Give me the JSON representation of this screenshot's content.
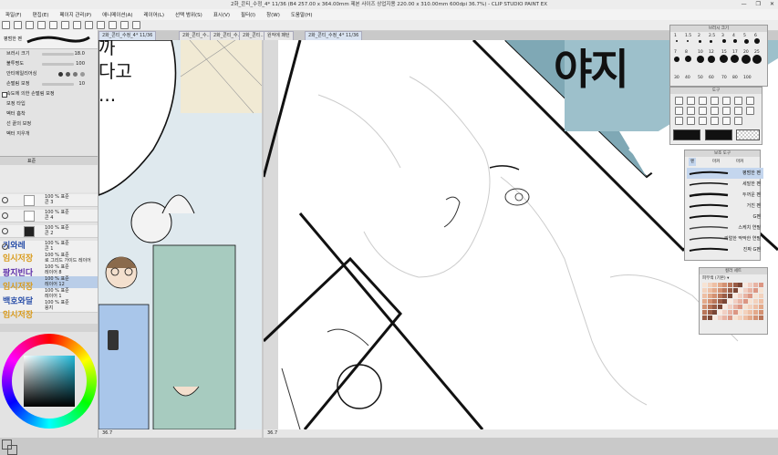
{
  "window": {
    "title": "2화_콘티_수정_4* 11/36 (B4 257.00 x 364.00mm 제본 사이즈 상업지용 220.00 x 310.00mm 600dpi 36.7%) - CLIP STUDIO PAINT EX",
    "controls": [
      "—",
      "❐",
      "✕"
    ]
  },
  "menu": [
    "파일(F)",
    "편집(E)",
    "페이지 관리(P)",
    "애니메이션(A)",
    "레이어(L)",
    "선택 범위(S)",
    "표시(V)",
    "필터(I)",
    "창(W)",
    "도움말(H)"
  ],
  "tool_property": {
    "rows": [
      {
        "label": "브러시 크기",
        "value": "18.0"
      },
      {
        "label": "불투명도",
        "value": "100"
      },
      {
        "label": "안티에일리어싱",
        "value": ""
      },
      {
        "label": "손떨림 보정",
        "value": "10"
      },
      {
        "label": "속도에 의한 손떨림 보정",
        "value": ""
      },
      {
        "label": "보정 타입",
        "value": ""
      },
      {
        "label": "벡터 흡착",
        "value": ""
      },
      {
        "label": "선 끝의 보정",
        "value": ""
      },
      {
        "label": "벡터 지우개",
        "value": ""
      }
    ],
    "brush_name": "평범한 펜"
  },
  "layers": {
    "blend_mode": "표준",
    "rows": [
      {
        "pct": "100 % 표준",
        "name": "콘 3"
      },
      {
        "pct": "100 % 표준",
        "name": "콘 4"
      },
      {
        "pct": "100 % 표준",
        "name": "콘 2"
      },
      {
        "pct": "100 % 표준",
        "name": "콘 1"
      },
      {
        "pct": "100 % 표준",
        "name": "로 그리드 가이드 레이어"
      },
      {
        "pct": "100 % 표준",
        "name": "레이어 8"
      },
      {
        "pct": "100 % 표준",
        "name": "레이어 12"
      },
      {
        "pct": "100 % 표준",
        "name": "레이어 1"
      },
      {
        "pct": "100 % 표준",
        "name": "용지"
      }
    ],
    "overlay_labels": [
      "기와레",
      "임시저장",
      "팡지빈다",
      "임시저장",
      "백호와달",
      "임시저장"
    ]
  },
  "color_wheel": {
    "main": "#1a1a1a",
    "sub": "#ffffff"
  },
  "canvas1": {
    "tab": "2화_콘티_수정_4* 11/36",
    "tabs_extra": [
      "2화_콘티_수..",
      "2화_콘티_수..",
      "2화_콘티.."
    ],
    "zoom": "36.7",
    "bubble_lines": [
      "까",
      "다고",
      "..."
    ]
  },
  "canvas2": {
    "tab": "2화_콘티_수정_4* 11/36",
    "tabs_extra": [
      "원작에 패턴"
    ],
    "zoom": "36.7",
    "big_text": "야지"
  },
  "brush_size_palette": {
    "title": "브러시 크기",
    "sizes": [
      "1",
      "1.5",
      "2",
      "2.5",
      "3",
      "4",
      "5",
      "6",
      "7",
      "8",
      "10",
      "12",
      "15",
      "17",
      "20",
      "25",
      "30",
      "40",
      "50",
      "60",
      "70",
      "80",
      "100"
    ]
  },
  "tool_palette": {
    "title": "도구"
  },
  "sub_tool_palette": {
    "title": "보조 도구",
    "tabs": [
      "펜",
      "마커",
      "마커"
    ],
    "brushes": [
      "평범한 펜",
      "세밀한 펜",
      "두꺼운 펜",
      "거친 펜",
      "G펜",
      "스케치 연필",
      "리얼한 딱딱한 연필",
      "진짜 G펜"
    ]
  },
  "color_set_palette": {
    "title": "컬러 세트",
    "set_name": "피부색 (기본) ▾"
  },
  "statusbar": {
    "left_zoom": "36.7",
    "right_zoom": "36.7"
  }
}
